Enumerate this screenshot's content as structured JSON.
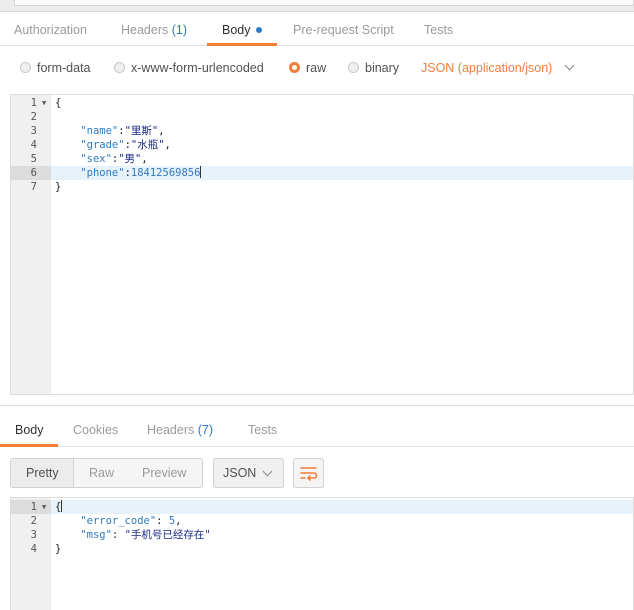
{
  "request": {
    "tabs": [
      {
        "label": "Authorization"
      },
      {
        "label": "Headers",
        "count": "(1)"
      },
      {
        "label": "Body",
        "active": true
      },
      {
        "label": "Pre-request Script"
      },
      {
        "label": "Tests"
      }
    ],
    "body_modes": [
      "form-data",
      "x-www-form-urlencoded",
      "raw",
      "binary"
    ],
    "selected_mode": "raw",
    "content_type": "JSON (application/json)",
    "editor_lines": [
      {
        "n": "1",
        "text": "{"
      },
      {
        "n": "2",
        "text": ""
      },
      {
        "n": "3",
        "key": "\"name\"",
        "value": "\"里斯\"",
        "tail": ","
      },
      {
        "n": "4",
        "key": "\"grade\"",
        "value": "\"水瓶\"",
        "tail": ","
      },
      {
        "n": "5",
        "key": "\"sex\"",
        "value": "\"男\"",
        "tail": ","
      },
      {
        "n": "6",
        "key": "\"phone\"",
        "value": "18412569856",
        "tail": ""
      },
      {
        "n": "7",
        "text": "}"
      }
    ]
  },
  "response": {
    "tabs": [
      {
        "label": "Body",
        "active": true
      },
      {
        "label": "Cookies"
      },
      {
        "label": "Headers",
        "count": "(7)"
      },
      {
        "label": "Tests"
      }
    ],
    "view_modes": [
      "Pretty",
      "Raw",
      "Preview"
    ],
    "active_view": "Pretty",
    "format": "JSON",
    "editor_lines": [
      {
        "n": "1",
        "text": "{"
      },
      {
        "n": "2",
        "key": "\"error_code\"",
        "value": "5",
        "tail": ","
      },
      {
        "n": "3",
        "key": "\"msg\"",
        "value": "\"手机号已经存在\"",
        "tail": ""
      },
      {
        "n": "4",
        "text": "}"
      }
    ]
  },
  "colors": {
    "accent": "#f27d3a",
    "link": "#2f7ac3"
  },
  "icons": {
    "wrap": "wrap-lines-icon",
    "fold": "fold-arrow-icon",
    "dropdown": "chevron-down-icon"
  }
}
